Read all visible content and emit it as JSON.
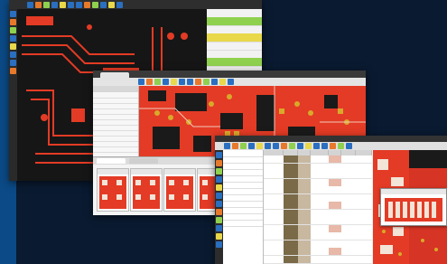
{
  "colors": {
    "board_bg": "#161616",
    "copper": "#e33b25",
    "pad_gold": "#d9a92a",
    "toolbar_dark": "#2e2e2e",
    "toolbar_light": "#e4e4e4",
    "icon_blue": "#2a6fc0",
    "icon_orange": "#e8792b",
    "highlight_green": "#8fd14f",
    "highlight_yellow": "#e8d84a",
    "desktop_blue": "#0b4a86"
  },
  "window_back": {
    "title": "",
    "toolbar_icons": [
      "select-icon",
      "move-icon",
      "route-icon",
      "via-icon",
      "zoom-icon",
      "grid-icon",
      "layer-icon",
      "drc-icon",
      "measure-icon",
      "pad-icon",
      "fill-icon",
      "text-icon"
    ],
    "side_icons": [
      "pointer-icon",
      "pan-icon",
      "zoom-in-icon",
      "zoom-out-icon",
      "route-icon",
      "via-icon",
      "measure-icon",
      "layers-icon"
    ],
    "properties_rows": [
      "",
      "",
      "",
      "",
      "",
      "",
      "",
      "",
      "",
      "",
      ""
    ]
  },
  "window_mid": {
    "title": "",
    "tab_label": "",
    "toolbar_icons": [
      "open-icon",
      "save-icon",
      "undo-icon",
      "redo-icon",
      "select-icon",
      "zoom-icon",
      "grid-icon",
      "layer-icon",
      "drc-icon",
      "3d-icon",
      "report-icon",
      "settings-icon"
    ],
    "left_panel_title": "",
    "left_panel_rows": [
      "",
      "",
      "",
      "",
      "",
      "",
      "",
      "",
      "",
      "",
      "",
      ""
    ],
    "view_label": "",
    "bottom_tab_1": "",
    "bottom_tab_2": "",
    "thumbnails": [
      "",
      "",
      "",
      "",
      "",
      ""
    ]
  },
  "window_front": {
    "title": "",
    "toolbar_icons": [
      "new-icon",
      "open-icon",
      "save-icon",
      "print-icon",
      "cut-icon",
      "copy-icon",
      "paste-icon",
      "undo-icon",
      "redo-icon",
      "select-icon",
      "zoom-icon",
      "grid-icon",
      "layer-icon",
      "drc-icon",
      "measure-icon",
      "report-icon"
    ],
    "tree_items": [
      "",
      "",
      "",
      "",
      "",
      "",
      "",
      "",
      "",
      "",
      "",
      ""
    ],
    "table_columns": [
      "",
      "",
      "",
      "",
      "",
      "",
      ""
    ],
    "table_rows": [
      [
        "",
        "",
        "",
        "",
        "",
        "",
        ""
      ],
      [
        "",
        "",
        "",
        "",
        "",
        "",
        ""
      ],
      [
        "",
        "",
        "",
        "",
        "",
        "",
        ""
      ],
      [
        "",
        "",
        "",
        "",
        "",
        "",
        ""
      ],
      [
        "",
        "",
        "",
        "",
        "",
        "",
        ""
      ],
      [
        "",
        "",
        "",
        "",
        "",
        "",
        ""
      ],
      [
        "",
        "",
        "",
        "",
        "",
        "",
        ""
      ],
      [
        "",
        "",
        "",
        "",
        "",
        "",
        ""
      ],
      [
        "",
        "",
        "",
        "",
        "",
        "",
        ""
      ],
      [
        "",
        "",
        "",
        "",
        "",
        "",
        ""
      ],
      [
        "",
        "",
        "",
        "",
        "",
        "",
        ""
      ],
      [
        "",
        "",
        "",
        "",
        "",
        "",
        ""
      ],
      [
        "",
        "",
        "",
        "",
        "",
        "",
        ""
      ],
      [
        "",
        "",
        "",
        "",
        "",
        "",
        ""
      ]
    ],
    "popup_label": ""
  }
}
